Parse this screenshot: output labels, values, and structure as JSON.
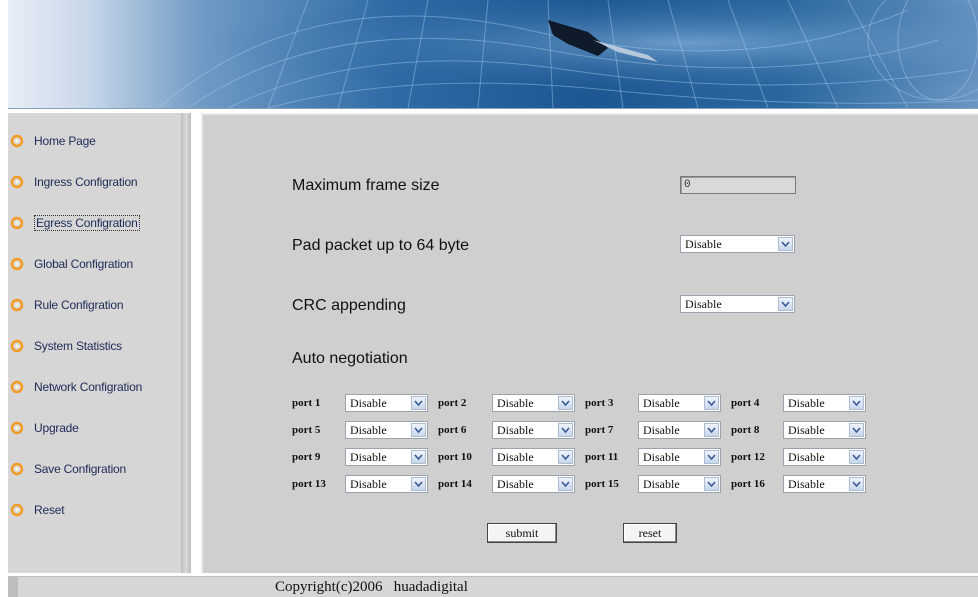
{
  "nav": {
    "items": [
      {
        "label": "Home Page"
      },
      {
        "label": "Ingress Configration"
      },
      {
        "label": "Egress Configration"
      },
      {
        "label": "Global Configration"
      },
      {
        "label": "Rule Configration"
      },
      {
        "label": "System Statistics"
      },
      {
        "label": "Network Configration"
      },
      {
        "label": "Upgrade"
      },
      {
        "label": "Save Configration"
      },
      {
        "label": "Reset"
      }
    ],
    "active_index": 2
  },
  "form": {
    "max_frame_label": "Maximum frame size",
    "max_frame_value": "0",
    "pad_label": "Pad packet up to 64 byte",
    "pad_value": "Disable",
    "crc_label": "CRC appending",
    "crc_value": "Disable",
    "auto_neg_label": "Auto negotiation",
    "ports": [
      {
        "label": "port 1",
        "value": "Disable"
      },
      {
        "label": "port 2",
        "value": "Disable"
      },
      {
        "label": "port 3",
        "value": "Disable"
      },
      {
        "label": "port 4",
        "value": "Disable"
      },
      {
        "label": "port 5",
        "value": "Disable"
      },
      {
        "label": "port 6",
        "value": "Disable"
      },
      {
        "label": "port 7",
        "value": "Disable"
      },
      {
        "label": "port 8",
        "value": "Disable"
      },
      {
        "label": "port 9",
        "value": "Disable"
      },
      {
        "label": "port 10",
        "value": "Disable"
      },
      {
        "label": "port 11",
        "value": "Disable"
      },
      {
        "label": "port 12",
        "value": "Disable"
      },
      {
        "label": "port 13",
        "value": "Disable"
      },
      {
        "label": "port 14",
        "value": "Disable"
      },
      {
        "label": "port 15",
        "value": "Disable"
      },
      {
        "label": "port 16",
        "value": "Disable"
      }
    ],
    "submit_label": "submit",
    "reset_label": "reset"
  },
  "footer": {
    "copyright": "Copyright(c)2006   huadadigital"
  },
  "icons": {
    "nav_bullet": "orange-ring-bullet-icon",
    "dropdown": "chevron-down-icon"
  },
  "colors": {
    "nav_text": "#1e2a55",
    "banner_blue": "#1d5793",
    "panel_gray": "#cfcfcf",
    "bullet_orange": "#f29a1f"
  }
}
